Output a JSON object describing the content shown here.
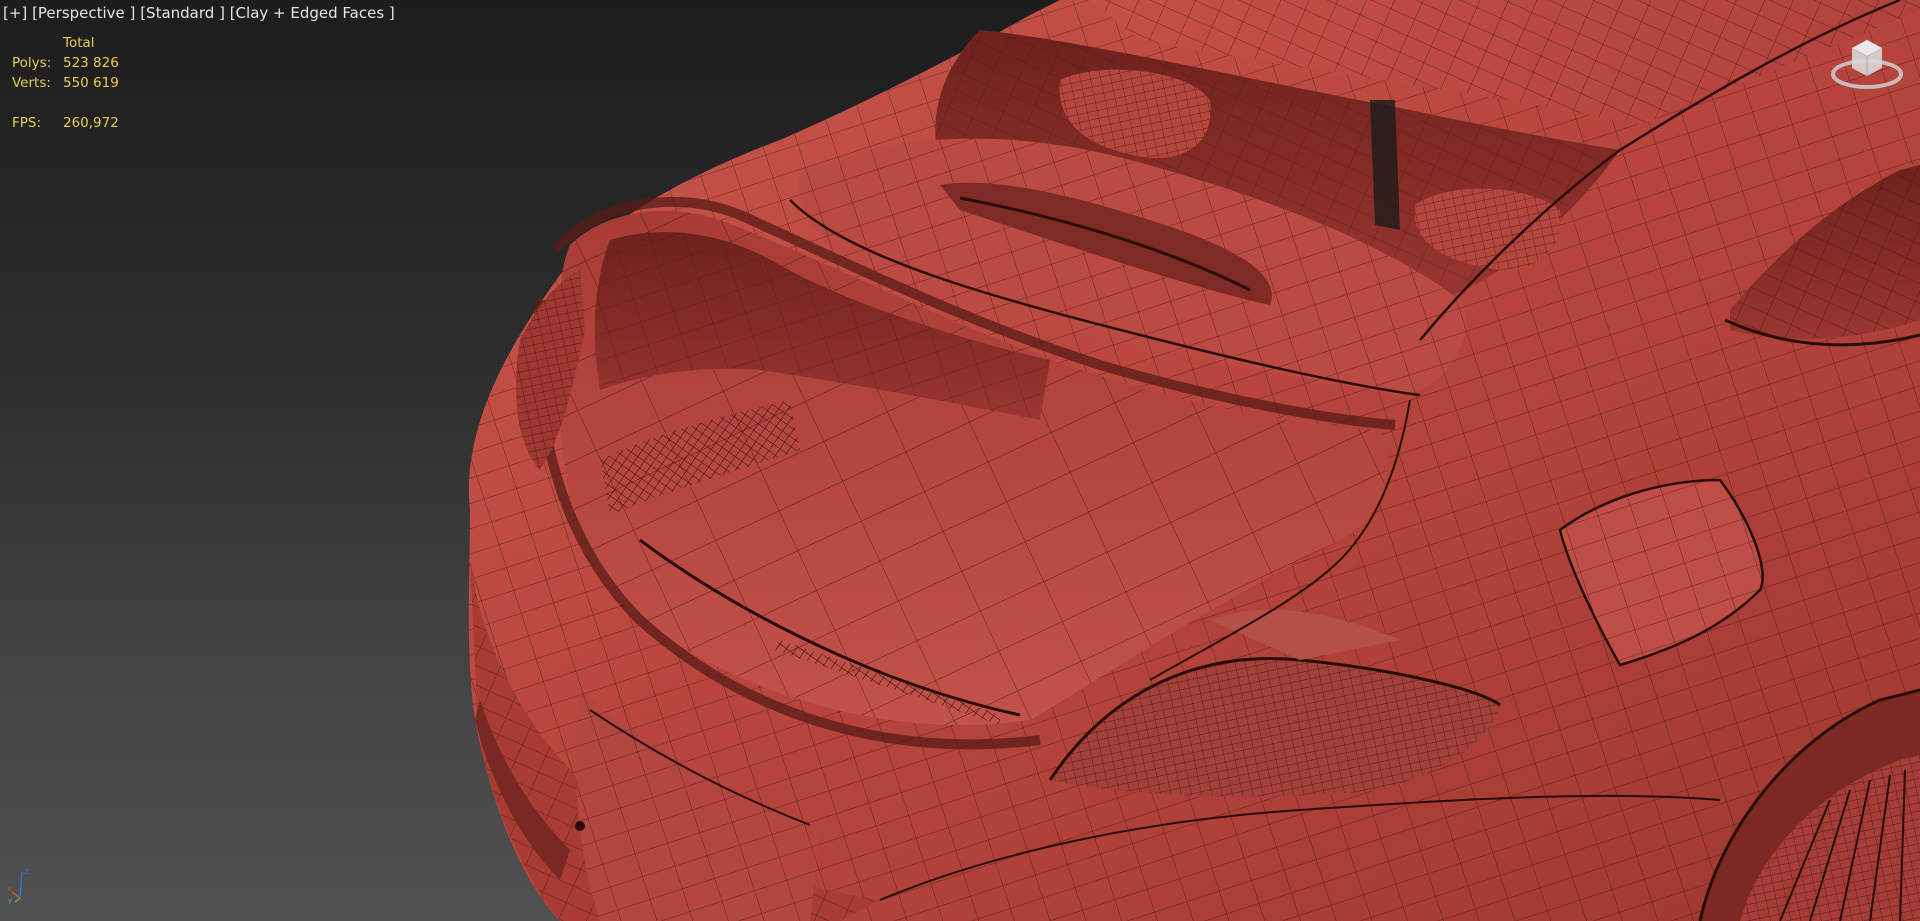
{
  "viewport": {
    "menu_plus": "[+]",
    "view_name": "[Perspective ]",
    "shading_standard": "[Standard ]",
    "display_mode": "[Clay + Edged Faces ]"
  },
  "stats": {
    "header": "Total",
    "polys_label": "Polys:",
    "polys_value": "523 826",
    "verts_label": "Verts:",
    "verts_value": "550 619",
    "fps_label": "FPS:",
    "fps_value": "260,972"
  },
  "axis": {
    "x": "x",
    "y": "y",
    "z": "z"
  },
  "colors": {
    "stats_text": "#e3cf55",
    "label_text": "#e6e6e6",
    "clay": "#bf4a42",
    "clay_dark": "#8f2f2a",
    "wire": "#3a1512",
    "bg_top": "#1d1d1d",
    "bg_bottom": "#515151"
  }
}
